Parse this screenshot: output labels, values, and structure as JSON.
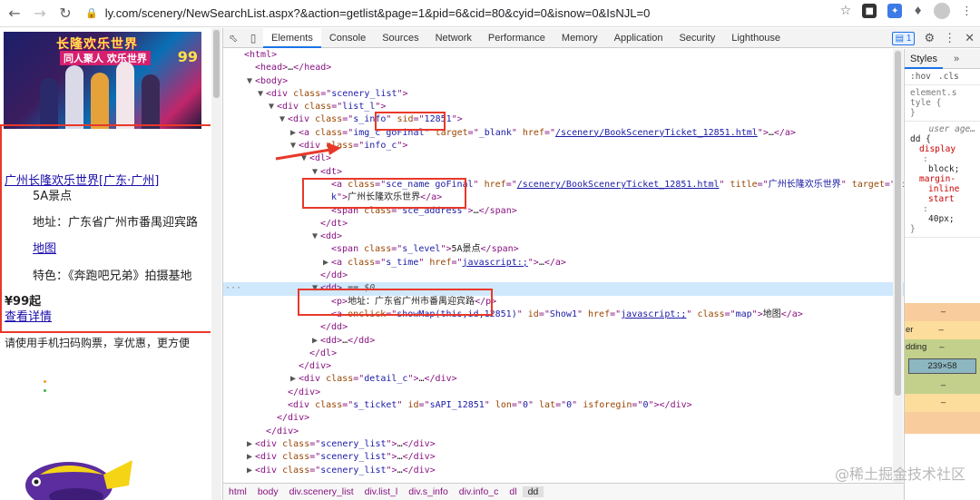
{
  "browser": {
    "url": "ly.com/scenery/NewSearchList.aspx?&action=getlist&page=1&pid=6&cid=80&cyid=0&isnow=0&IsNJL=0",
    "back_icon": "back-arrow-icon",
    "forward_icon": "forward-arrow-icon",
    "reload_icon": "reload-icon"
  },
  "page": {
    "banner": {
      "title": "长隆欢乐世界",
      "subtitle": "同人聚人 欢乐世界",
      "price_tag": "99"
    },
    "poi_name": "广州长隆欢乐世界",
    "poi_region_prefix": "[广东·",
    "poi_city": "广州",
    "poi_region_suffix": "]",
    "level": "5A景点",
    "address": "地址：广东省广州市番禺迎宾路",
    "map_link": "地图",
    "feature": "特色：《奔跑吧兄弟》拍摄基地",
    "price": "¥99起",
    "detail_link": "查看详情",
    "app_promo": "请使用手机扫码购票，享优惠，更方便"
  },
  "devtools": {
    "tabs": [
      "Elements",
      "Console",
      "Sources",
      "Network",
      "Performance",
      "Memory",
      "Application",
      "Security",
      "Lighthouse"
    ],
    "active_tab": "Elements",
    "issues_count": "1",
    "dom_lines": [
      {
        "indent": 0,
        "tri": "",
        "parts": [
          [
            "tg",
            "<html>"
          ]
        ]
      },
      {
        "indent": 1,
        "tri": "",
        "parts": [
          [
            "tg",
            "<head>"
          ],
          [
            "tx",
            "…"
          ],
          [
            "tg",
            "</head>"
          ]
        ]
      },
      {
        "indent": 1,
        "tri": "▼",
        "parts": [
          [
            "tg",
            "<body>"
          ]
        ]
      },
      {
        "indent": 2,
        "tri": "▼",
        "parts": [
          [
            "tg",
            "<div "
          ],
          [
            "an",
            "class"
          ],
          [
            "tg",
            "=\""
          ],
          [
            "av",
            "scenery_list"
          ],
          [
            "tg",
            "\">"
          ]
        ]
      },
      {
        "indent": 3,
        "tri": "▼",
        "parts": [
          [
            "tg",
            "<div "
          ],
          [
            "an",
            "class"
          ],
          [
            "tg",
            "=\""
          ],
          [
            "av",
            "list_l"
          ],
          [
            "tg",
            "\">"
          ]
        ]
      },
      {
        "indent": 4,
        "tri": "▼",
        "parts": [
          [
            "tg",
            "<div "
          ],
          [
            "an",
            "class"
          ],
          [
            "tg",
            "=\""
          ],
          [
            "av",
            "s_info"
          ],
          [
            "tg",
            "\" "
          ],
          [
            "an",
            "sid"
          ],
          [
            "tg",
            "=\""
          ],
          [
            "av",
            "12851"
          ],
          [
            "tg",
            "\">"
          ]
        ]
      },
      {
        "indent": 5,
        "tri": "▶",
        "parts": [
          [
            "tg",
            "<a "
          ],
          [
            "an",
            "class"
          ],
          [
            "tg",
            "=\""
          ],
          [
            "av",
            "img_c goFinal"
          ],
          [
            "tg",
            "\" "
          ],
          [
            "an",
            "target"
          ],
          [
            "tg",
            "=\""
          ],
          [
            "av",
            "_blank"
          ],
          [
            "tg",
            "\" "
          ],
          [
            "an",
            "href"
          ],
          [
            "tg",
            "=\""
          ],
          [
            "avl",
            "/scenery/BookSceneryTicket_12851.html"
          ],
          [
            "tg",
            "\">"
          ],
          [
            "tx",
            "…"
          ],
          [
            "tg",
            "</a>"
          ]
        ]
      },
      {
        "indent": 5,
        "tri": "▼",
        "parts": [
          [
            "tg",
            "<div "
          ],
          [
            "an",
            "class"
          ],
          [
            "tg",
            "=\""
          ],
          [
            "av",
            "info_c"
          ],
          [
            "tg",
            "\">"
          ]
        ]
      },
      {
        "indent": 6,
        "tri": "▼",
        "parts": [
          [
            "tg",
            "<dl>"
          ]
        ]
      },
      {
        "indent": 7,
        "tri": "▼",
        "parts": [
          [
            "tg",
            "<dt>"
          ]
        ]
      },
      {
        "indent": 8,
        "tri": "",
        "parts": [
          [
            "tg",
            "<a "
          ],
          [
            "an",
            "class"
          ],
          [
            "tg",
            "=\""
          ],
          [
            "av",
            "sce_name goFinal"
          ],
          [
            "tg",
            "\" "
          ],
          [
            "an",
            "href"
          ],
          [
            "tg",
            "=\""
          ],
          [
            "avl",
            "/scenery/BookSceneryTicket_12851.html"
          ],
          [
            "tg",
            "\" "
          ],
          [
            "an",
            "title"
          ],
          [
            "tg",
            "=\""
          ],
          [
            "av",
            "广州长隆欢乐世界"
          ],
          [
            "tg",
            "\" "
          ],
          [
            "an",
            "target"
          ],
          [
            "tg",
            "=\""
          ],
          [
            "av",
            "_blan"
          ]
        ]
      },
      {
        "indent": 8,
        "tri": "",
        "parts": [
          [
            "av",
            "k"
          ],
          [
            "tg",
            "\">"
          ],
          [
            "tx",
            "广州长隆欢乐世界"
          ],
          [
            "tg",
            "</a>"
          ]
        ]
      },
      {
        "indent": 8,
        "tri": "",
        "parts": [
          [
            "tg",
            "<span "
          ],
          [
            "an",
            "class"
          ],
          [
            "tg",
            "=\""
          ],
          [
            "av",
            "sce_address"
          ],
          [
            "tg",
            "\">"
          ],
          [
            "tx",
            "…"
          ],
          [
            "tg",
            "</span>"
          ]
        ]
      },
      {
        "indent": 7,
        "tri": "",
        "parts": [
          [
            "tg",
            "</dt>"
          ]
        ]
      },
      {
        "indent": 7,
        "tri": "▼",
        "parts": [
          [
            "tg",
            "<dd>"
          ]
        ]
      },
      {
        "indent": 8,
        "tri": "",
        "parts": [
          [
            "tg",
            "<span "
          ],
          [
            "an",
            "class"
          ],
          [
            "tg",
            "=\""
          ],
          [
            "av",
            "s_level"
          ],
          [
            "tg",
            "\">"
          ],
          [
            "tx",
            "5A景点"
          ],
          [
            "tg",
            "</span>"
          ]
        ]
      },
      {
        "indent": 8,
        "tri": "▶",
        "parts": [
          [
            "tg",
            "<a "
          ],
          [
            "an",
            "class"
          ],
          [
            "tg",
            "=\""
          ],
          [
            "av",
            "s_time"
          ],
          [
            "tg",
            "\" "
          ],
          [
            "an",
            "href"
          ],
          [
            "tg",
            "=\""
          ],
          [
            "avl",
            "javascript:;"
          ],
          [
            "tg",
            "\">"
          ],
          [
            "tx",
            "…"
          ],
          [
            "tg",
            "</a>"
          ]
        ]
      },
      {
        "indent": 7,
        "tri": "",
        "parts": [
          [
            "tg",
            "</dd>"
          ]
        ]
      },
      {
        "indent": 7,
        "tri": "▼",
        "selected": true,
        "parts": [
          [
            "tg",
            "<dd>"
          ],
          [
            "tx",
            " == "
          ],
          [
            "cm",
            "$0"
          ]
        ]
      },
      {
        "indent": 8,
        "tri": "",
        "parts": [
          [
            "tg",
            "<p>"
          ],
          [
            "tx",
            "地址：广东省广州市番禺迎宾路"
          ],
          [
            "tg",
            "</p>"
          ]
        ]
      },
      {
        "indent": 8,
        "tri": "",
        "parts": [
          [
            "tg",
            "<a "
          ],
          [
            "an",
            "onclick"
          ],
          [
            "tg",
            "=\""
          ],
          [
            "av",
            "showMap(this,id,12851)"
          ],
          [
            "tg",
            "\" "
          ],
          [
            "an",
            "id"
          ],
          [
            "tg",
            "=\""
          ],
          [
            "av",
            "Show1"
          ],
          [
            "tg",
            "\" "
          ],
          [
            "an",
            "href"
          ],
          [
            "tg",
            "=\""
          ],
          [
            "avl",
            "javascript:;"
          ],
          [
            "tg",
            "\" "
          ],
          [
            "an",
            "class"
          ],
          [
            "tg",
            "=\""
          ],
          [
            "av",
            "map"
          ],
          [
            "tg",
            "\">"
          ],
          [
            "tx",
            "地图"
          ],
          [
            "tg",
            "</a>"
          ]
        ]
      },
      {
        "indent": 7,
        "tri": "",
        "parts": [
          [
            "tg",
            "</dd>"
          ]
        ]
      },
      {
        "indent": 7,
        "tri": "▶",
        "parts": [
          [
            "tg",
            "<dd>"
          ],
          [
            "tx",
            "…"
          ],
          [
            "tg",
            "</dd>"
          ]
        ]
      },
      {
        "indent": 6,
        "tri": "",
        "parts": [
          [
            "tg",
            "</dl>"
          ]
        ]
      },
      {
        "indent": 5,
        "tri": "",
        "parts": [
          [
            "tg",
            "</div>"
          ]
        ]
      },
      {
        "indent": 5,
        "tri": "▶",
        "parts": [
          [
            "tg",
            "<div "
          ],
          [
            "an",
            "class"
          ],
          [
            "tg",
            "=\""
          ],
          [
            "av",
            "detail_c"
          ],
          [
            "tg",
            "\">"
          ],
          [
            "tx",
            "…"
          ],
          [
            "tg",
            "</div>"
          ]
        ]
      },
      {
        "indent": 4,
        "tri": "",
        "parts": [
          [
            "tg",
            "</div>"
          ]
        ]
      },
      {
        "indent": 4,
        "tri": "",
        "parts": [
          [
            "tg",
            "<div "
          ],
          [
            "an",
            "class"
          ],
          [
            "tg",
            "=\""
          ],
          [
            "av",
            "s_ticket"
          ],
          [
            "tg",
            "\" "
          ],
          [
            "an",
            "id"
          ],
          [
            "tg",
            "=\""
          ],
          [
            "av",
            "sAPI_12851"
          ],
          [
            "tg",
            "\" "
          ],
          [
            "an",
            "lon"
          ],
          [
            "tg",
            "=\""
          ],
          [
            "av",
            "0"
          ],
          [
            "tg",
            "\" "
          ],
          [
            "an",
            "lat"
          ],
          [
            "tg",
            "=\""
          ],
          [
            "av",
            "0"
          ],
          [
            "tg",
            "\" "
          ],
          [
            "an",
            "isforegin"
          ],
          [
            "tg",
            "=\""
          ],
          [
            "av",
            "0"
          ],
          [
            "tg",
            "\">"
          ],
          [
            "tg",
            "</div>"
          ]
        ]
      },
      {
        "indent": 3,
        "tri": "",
        "parts": [
          [
            "tg",
            "</div>"
          ]
        ]
      },
      {
        "indent": 2,
        "tri": "",
        "parts": [
          [
            "tg",
            "</div>"
          ]
        ]
      },
      {
        "indent": 1,
        "tri": "▶",
        "parts": [
          [
            "tg",
            "<div "
          ],
          [
            "an",
            "class"
          ],
          [
            "tg",
            "=\""
          ],
          [
            "av",
            "scenery_list"
          ],
          [
            "tg",
            "\">"
          ],
          [
            "tx",
            "…"
          ],
          [
            "tg",
            "</div>"
          ]
        ]
      },
      {
        "indent": 1,
        "tri": "▶",
        "parts": [
          [
            "tg",
            "<div "
          ],
          [
            "an",
            "class"
          ],
          [
            "tg",
            "=\""
          ],
          [
            "av",
            "scenery_list"
          ],
          [
            "tg",
            "\">"
          ],
          [
            "tx",
            "…"
          ],
          [
            "tg",
            "</div>"
          ]
        ]
      },
      {
        "indent": 1,
        "tri": "▶",
        "parts": [
          [
            "tg",
            "<div "
          ],
          [
            "an",
            "class"
          ],
          [
            "tg",
            "=\""
          ],
          [
            "av",
            "scenery_list"
          ],
          [
            "tg",
            "\">"
          ],
          [
            "tx",
            "…"
          ],
          [
            "tg",
            "</div>"
          ]
        ]
      }
    ],
    "breadcrumbs": [
      "html",
      "body",
      "div.scenery_list",
      "div.list_l",
      "div.s_info",
      "div.info_c",
      "dl",
      "dd"
    ],
    "styles": {
      "tab": "Styles",
      "more": "»",
      "filter_hov": ":hov",
      "filter_cls": ".cls",
      "element_style_1": "element.s",
      "element_style_2": "tyle {",
      "close_brace": "}",
      "ua_label": "user age…",
      "dd_selector": "dd {",
      "prop_display": "display",
      "colon": ":",
      "val_block": "block;",
      "prop_margin_1": "margin-",
      "prop_margin_2": "inline",
      "prop_margin_3": "start",
      "val_40": "40px;",
      "box_dash_1": "–",
      "box_border": "er",
      "box_dash_2": "–",
      "box_padding": "dding",
      "box_dash_3": "–",
      "box_size": "239×58",
      "box_dash_4": "–",
      "box_dash_5": "–"
    }
  },
  "watermark": "@稀土掘金技术社区",
  "colors": {
    "annotation_red": "#e8382a",
    "link_blue": "#1a0dab",
    "tag_purple": "#881280",
    "attr_name": "#994500",
    "attr_value": "#1a1aa6",
    "selected_row": "#cfe8fc"
  }
}
